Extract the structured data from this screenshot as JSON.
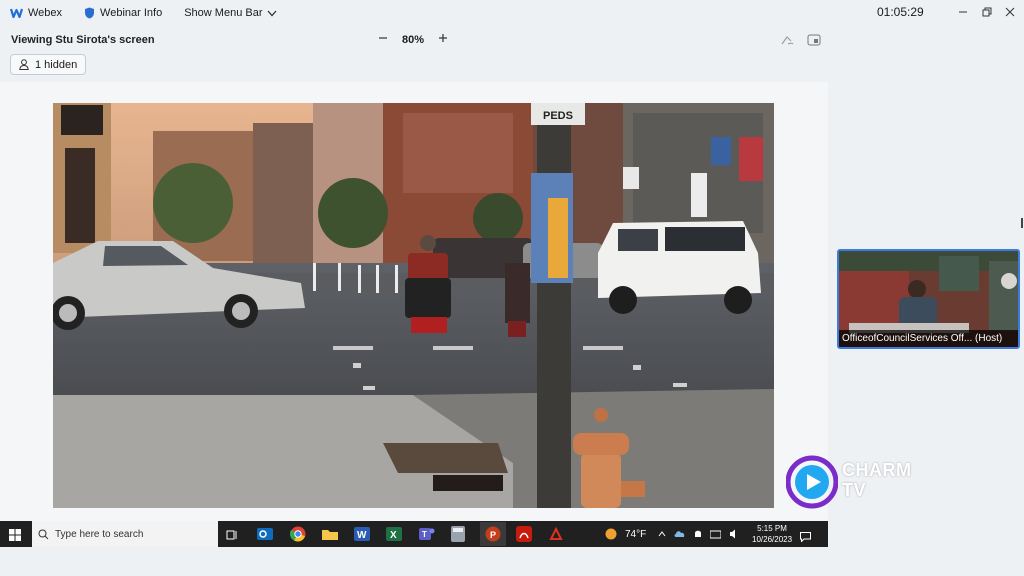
{
  "app": {
    "name": "Webex",
    "webinar_info": "Webinar Info",
    "show_menu_bar": "Show Menu Bar",
    "clock": "01:05:29"
  },
  "viewbar": {
    "viewing_label": "Viewing Stu Sirota's screen",
    "zoom_value": "80%"
  },
  "hidden_button": {
    "label": "1 hidden"
  },
  "shared_screen": {
    "street_sign": "PEDS",
    "taskbar": {
      "search_placeholder": "Type here to search",
      "temperature": "74°F",
      "time": "5:15 PM",
      "date": "10/26/2023"
    }
  },
  "participant": {
    "name": "OfficeofCouncilServices Off... (Host)"
  },
  "logo": {
    "line1": "CHARM",
    "line2": "TV"
  },
  "colors": {
    "accent_blue": "#3c7ce0",
    "taskbar": "#202020",
    "logo_purple": "#7b2cc9",
    "logo_cyan": "#22a8f0"
  }
}
